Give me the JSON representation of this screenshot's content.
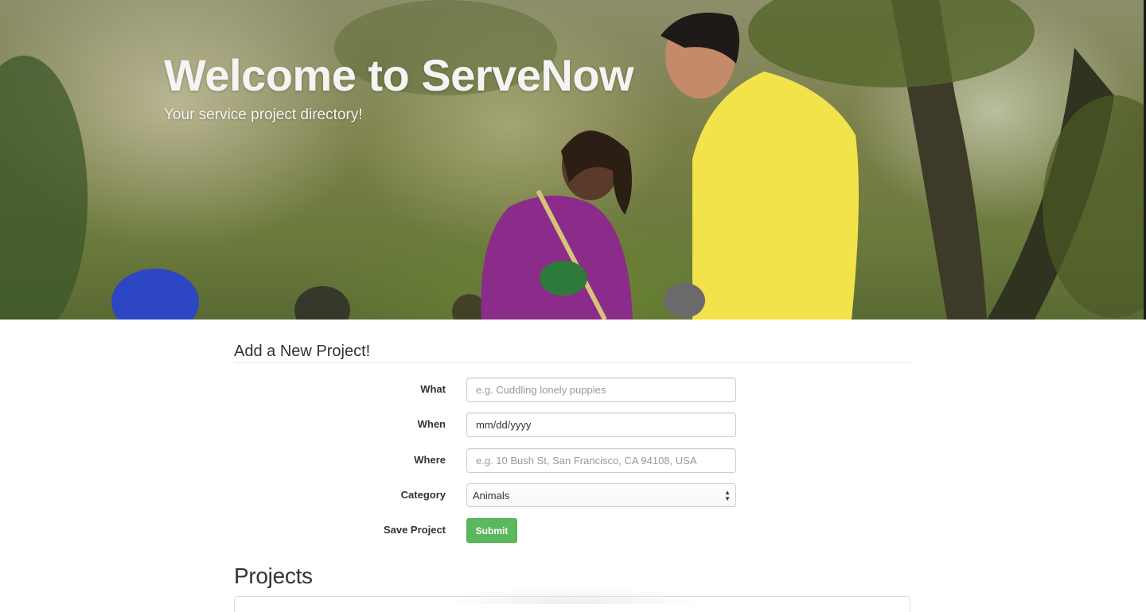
{
  "hero": {
    "title": "Welcome to ServeNow",
    "subtitle": "Your service project directory!"
  },
  "form": {
    "legend": "Add a New Project!",
    "fields": [
      {
        "label": "What",
        "placeholder": "e.g. Cuddling lonely puppies",
        "value": ""
      },
      {
        "label": "When",
        "placeholder": "",
        "value": "mm/dd/yyyy"
      },
      {
        "label": "Where",
        "placeholder": "e.g. 10 Bush St, San Francisco, CA 94108, USA",
        "value": ""
      },
      {
        "label": "Category",
        "selected": "Animals"
      }
    ],
    "save_label": "Save Project",
    "submit_label": "Submit"
  },
  "projects": {
    "heading": "Projects"
  },
  "colors": {
    "submit_green": "#5cb85c",
    "submit_border": "#4cae4c",
    "hero_text": "#f4f4f2"
  }
}
